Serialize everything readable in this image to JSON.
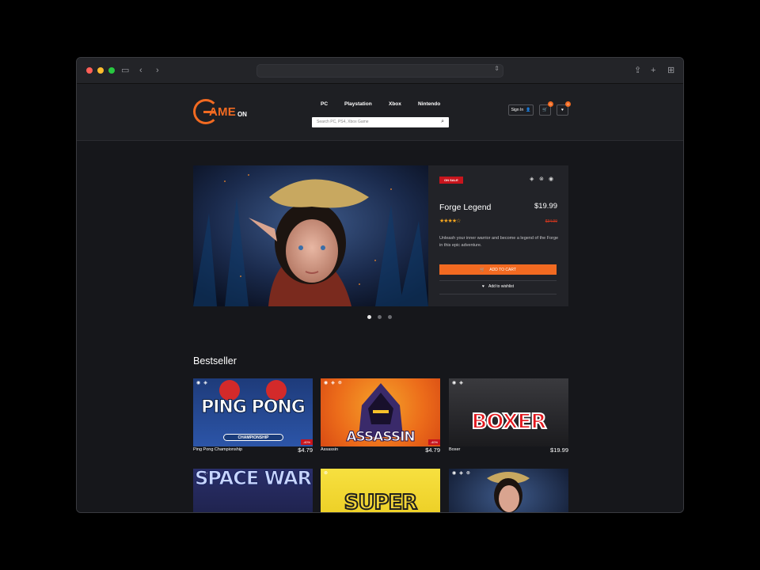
{
  "browser": {
    "traffic_lights": [
      "#ff5f57",
      "#febc2e",
      "#28c840"
    ]
  },
  "nav": {
    "logo_main": "AME",
    "logo_suffix": "ON",
    "links": [
      "PC",
      "Playstation",
      "Xbox",
      "Nintendo"
    ],
    "search_placeholder": "Search PC, PS4, Xbox Game",
    "sign_in": "Sign In",
    "cart_count": "0",
    "wishlist_count": "0"
  },
  "hero": {
    "badge": "ON SALE",
    "title": "Forge Legend",
    "price": "$19.99",
    "rating": 4,
    "old_price": "$34.99",
    "description": "Unleash your inner warrior and become a legend of the Forge in this epic adventure.",
    "add_to_cart": "ADD TO CART",
    "add_to_wishlist": "Add to wishlist",
    "slides": 3,
    "active_slide": 0
  },
  "bestseller": {
    "heading": "Bestseller",
    "items": [
      {
        "name": "Ping Pong Championship",
        "price": "$4.79",
        "discount": "-40%",
        "art": "PING PONG",
        "sub": "CHAMPIONSHIP"
      },
      {
        "name": "Assassin",
        "price": "$4.79",
        "discount": "-40%",
        "art": "ASSASSIN"
      },
      {
        "name": "Boxer",
        "price": "$19.99",
        "art": "BOXER"
      },
      {
        "art": "SPACE WAR"
      },
      {
        "art": "SUPER"
      },
      {}
    ]
  },
  "colors": {
    "accent": "#f26a21",
    "sale": "#c8151d",
    "star": "#f3a51f"
  }
}
